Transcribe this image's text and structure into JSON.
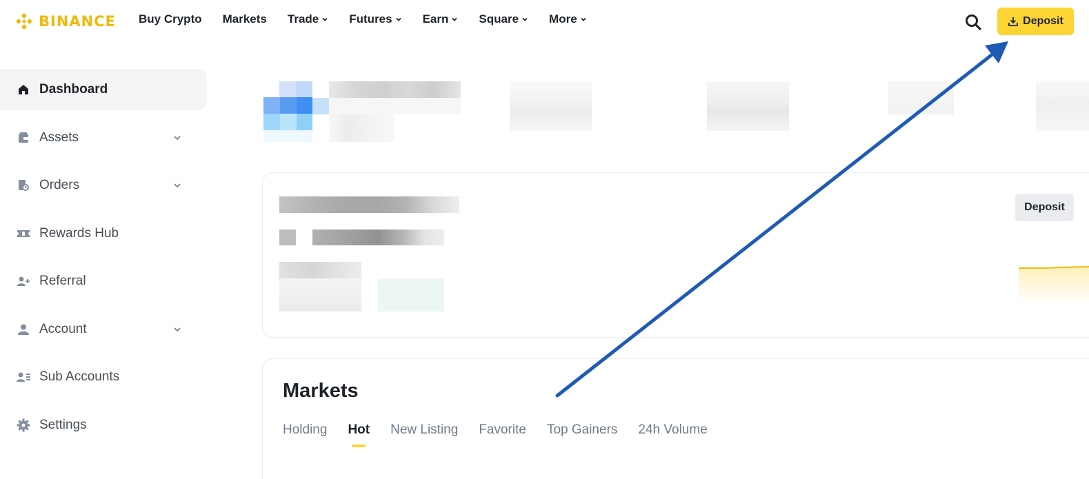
{
  "brand": {
    "name": "BINANCE",
    "color": "#f0b90b",
    "icon": "binance-logo-icon"
  },
  "nav": {
    "links": [
      {
        "label": "Buy Crypto",
        "has_dropdown": false
      },
      {
        "label": "Markets",
        "has_dropdown": false
      },
      {
        "label": "Trade",
        "has_dropdown": true
      },
      {
        "label": "Futures",
        "has_dropdown": true
      },
      {
        "label": "Earn",
        "has_dropdown": true
      },
      {
        "label": "Square",
        "has_dropdown": true
      },
      {
        "label": "More",
        "has_dropdown": true
      }
    ],
    "search_icon": "search-icon",
    "deposit_label": "Deposit",
    "deposit_color": "#fcd535"
  },
  "sidebar": {
    "items": [
      {
        "label": "Dashboard",
        "icon": "home-icon",
        "active": true,
        "has_dropdown": false
      },
      {
        "label": "Assets",
        "icon": "wallet-icon",
        "active": false,
        "has_dropdown": true
      },
      {
        "label": "Orders",
        "icon": "orders-icon",
        "active": false,
        "has_dropdown": true
      },
      {
        "label": "Rewards Hub",
        "icon": "ticket-icon",
        "active": false,
        "has_dropdown": false
      },
      {
        "label": "Referral",
        "icon": "add-user-icon",
        "active": false,
        "has_dropdown": false
      },
      {
        "label": "Account",
        "icon": "user-icon",
        "active": false,
        "has_dropdown": true
      },
      {
        "label": "Sub Accounts",
        "icon": "sub-accounts-icon",
        "active": false,
        "has_dropdown": false
      },
      {
        "label": "Settings",
        "icon": "gear-icon",
        "active": false,
        "has_dropdown": false
      }
    ]
  },
  "balance_card": {
    "deposit_label": "Deposit"
  },
  "markets": {
    "title": "Markets",
    "tabs": [
      {
        "label": "Holding",
        "active": false
      },
      {
        "label": "Hot",
        "active": true
      },
      {
        "label": "New Listing",
        "active": false
      },
      {
        "label": "Favorite",
        "active": false
      },
      {
        "label": "Top Gainers",
        "active": false
      },
      {
        "label": "24h Volume",
        "active": false
      }
    ]
  },
  "annotation": {
    "arrow_color": "#1f5bb5"
  }
}
